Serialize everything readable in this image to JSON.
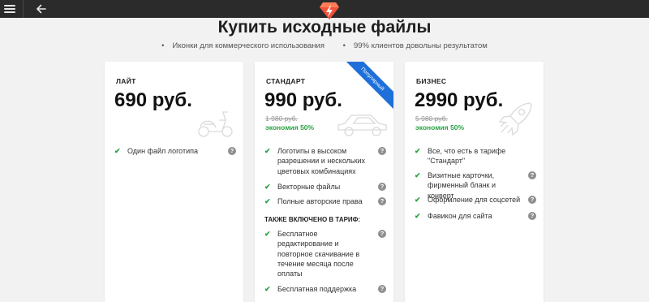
{
  "page": {
    "title": "Купить исходные файлы",
    "bullets": [
      "Иконки для коммерческого использования",
      "99% клиентов довольны результатом"
    ]
  },
  "colors": {
    "accent_green": "#2aa343",
    "ribbon_blue": "#1e6fd9",
    "topbar": "#2b2b2b"
  },
  "plans": [
    {
      "name": "ЛАЙТ",
      "price": "690 руб.",
      "illustration": "scooter-icon",
      "features": [
        {
          "text": "Один файл логотипа"
        }
      ]
    },
    {
      "name": "СТАНДАРТ",
      "price": "990 руб.",
      "old_price": "1 980 руб.",
      "discount": "экономия 50%",
      "badge": "Популярный",
      "illustration": "car-icon",
      "features": [
        {
          "text": "Логотипы в высоком разрешении и нескольких цветовых комбинациях"
        },
        {
          "text": "Векторные файлы"
        },
        {
          "text": "Полные авторские права"
        }
      ],
      "extra_heading": "ТАКЖЕ ВКЛЮЧЕНО В ТАРИФ:",
      "extra_features": [
        {
          "text": "Бесплатное редактирование и повторное скачивание в течение месяца после оплаты"
        },
        {
          "text": "Бесплатная поддержка"
        }
      ]
    },
    {
      "name": "БИЗНЕС",
      "price": "2990 руб.",
      "old_price": "5 980 руб.",
      "discount": "экономия 50%",
      "illustration": "rocket-icon",
      "features": [
        {
          "text": "Все, что есть в тарифе \"Стандарт\""
        },
        {
          "text": "Визитные карточки, фирменный бланк и конверт"
        },
        {
          "text": "Оформление для соцсетей"
        },
        {
          "text": "Фавикон для сайта"
        }
      ]
    }
  ],
  "icons": {
    "menu": "hamburger-icon",
    "back": "arrow-left-icon",
    "logo": "brand-logo",
    "check": "check-icon",
    "help": "question-icon"
  },
  "help_glyph": "?",
  "check_glyph": "✔",
  "bullet_glyph": "•"
}
